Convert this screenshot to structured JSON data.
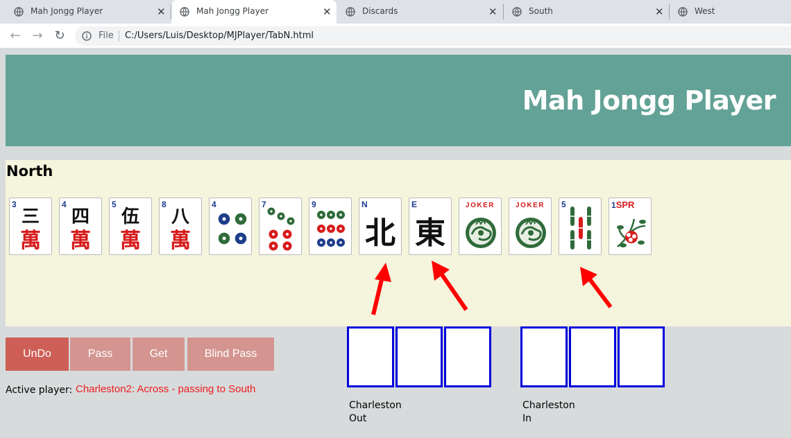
{
  "browser": {
    "tabs": [
      {
        "title": "Mah Jongg Player",
        "active": false
      },
      {
        "title": "Mah Jongg Player",
        "active": true
      },
      {
        "title": "Discards",
        "active": false
      },
      {
        "title": "South",
        "active": false
      },
      {
        "title": "West",
        "active": false
      }
    ],
    "file_label": "File",
    "url": "C:/Users/Luis/Desktop/MJPlayer/TabN.html"
  },
  "header": {
    "title": "Mah Jongg Player",
    "bg_color": "#63a296"
  },
  "board": {
    "player": "North",
    "bg_color": "#f5f5dd",
    "tiles": [
      {
        "kind": "character",
        "number": "3",
        "top": "三",
        "bottom": "萬"
      },
      {
        "kind": "character",
        "number": "4",
        "top": "四",
        "bottom": "萬"
      },
      {
        "kind": "character",
        "number": "5",
        "top": "伍",
        "bottom": "萬"
      },
      {
        "kind": "character",
        "number": "8",
        "top": "八",
        "bottom": "萬"
      },
      {
        "kind": "dot",
        "number": "4",
        "count": 4
      },
      {
        "kind": "dot",
        "number": "7",
        "count": 7
      },
      {
        "kind": "dot",
        "number": "9",
        "count": 9
      },
      {
        "kind": "wind",
        "number": "N",
        "glyph": "北"
      },
      {
        "kind": "wind",
        "number": "E",
        "glyph": "東"
      },
      {
        "kind": "joker",
        "label": "JOKER"
      },
      {
        "kind": "joker",
        "label": "JOKER"
      },
      {
        "kind": "bam",
        "number": "5",
        "count": 5
      },
      {
        "kind": "flower",
        "number": "1",
        "label": "SPR"
      }
    ],
    "arrow_color": "#ff0000"
  },
  "controls": {
    "undo": "UnDo",
    "pass": "Pass",
    "get": "Get",
    "blind_pass": "Blind Pass"
  },
  "status": {
    "active_label": "Active player:",
    "active_value": "Charleston2: Across - passing to South"
  },
  "charleston": {
    "out_label_line1": "Charleston",
    "out_label_line2": "Out",
    "in_label_line1": "Charleston",
    "in_label_line2": "In",
    "slot_border_color": "#0000dd"
  }
}
